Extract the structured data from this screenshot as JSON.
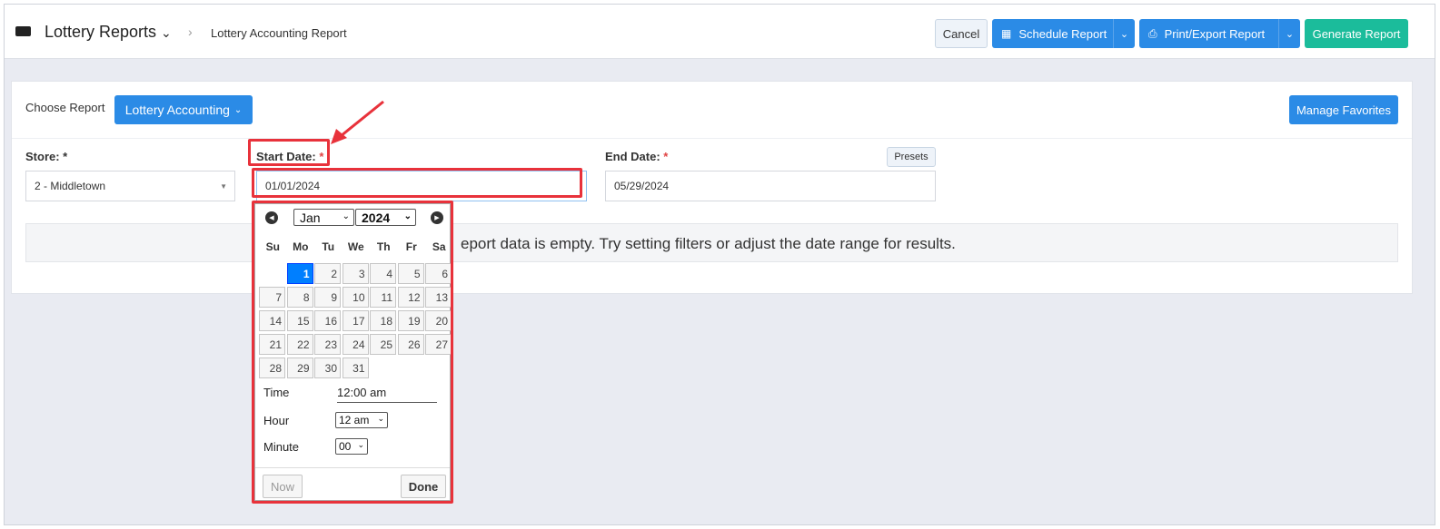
{
  "header": {
    "app_title": "Lottery Reports",
    "breadcrumb": "Lottery Accounting Report",
    "cancel_label": "Cancel",
    "schedule_label": "Schedule Report",
    "print_label": "Print/Export Report",
    "generate_label": "Generate Report"
  },
  "panel": {
    "choose_label": "Choose Report",
    "report_selected": "Lottery Accounting",
    "manage_favorites_label": "Manage Favorites",
    "store_label": "Store: *",
    "store_value": "2 - Middletown",
    "start_label": "Start Date:",
    "start_value": "01/01/2024",
    "end_label": "End Date:",
    "end_value": "05/29/2024",
    "required_mark": "*",
    "presets_label": "Presets",
    "empty_message": "eport data is empty. Try setting filters or adjust the date range for results."
  },
  "datepicker": {
    "month": "Jan",
    "year": "2024",
    "weekdays": [
      "Su",
      "Mo",
      "Tu",
      "We",
      "Th",
      "Fr",
      "Sa"
    ],
    "weeks": [
      [
        "",
        "1",
        "2",
        "3",
        "4",
        "5",
        "6"
      ],
      [
        "7",
        "8",
        "9",
        "10",
        "11",
        "12",
        "13"
      ],
      [
        "14",
        "15",
        "16",
        "17",
        "18",
        "19",
        "20"
      ],
      [
        "21",
        "22",
        "23",
        "24",
        "25",
        "26",
        "27"
      ],
      [
        "28",
        "29",
        "30",
        "31",
        "",
        "",
        ""
      ]
    ],
    "selected_day": "1",
    "time_label": "Time",
    "time_value": "12:00 am",
    "hour_label": "Hour",
    "hour_value": "12 am",
    "minute_label": "Minute",
    "minute_value": "00",
    "now_label": "Now",
    "done_label": "Done"
  },
  "colors": {
    "primary": "#2b8be6",
    "success": "#1bbc9b",
    "highlight": "#e8323b",
    "selected_day": "#007fff"
  }
}
